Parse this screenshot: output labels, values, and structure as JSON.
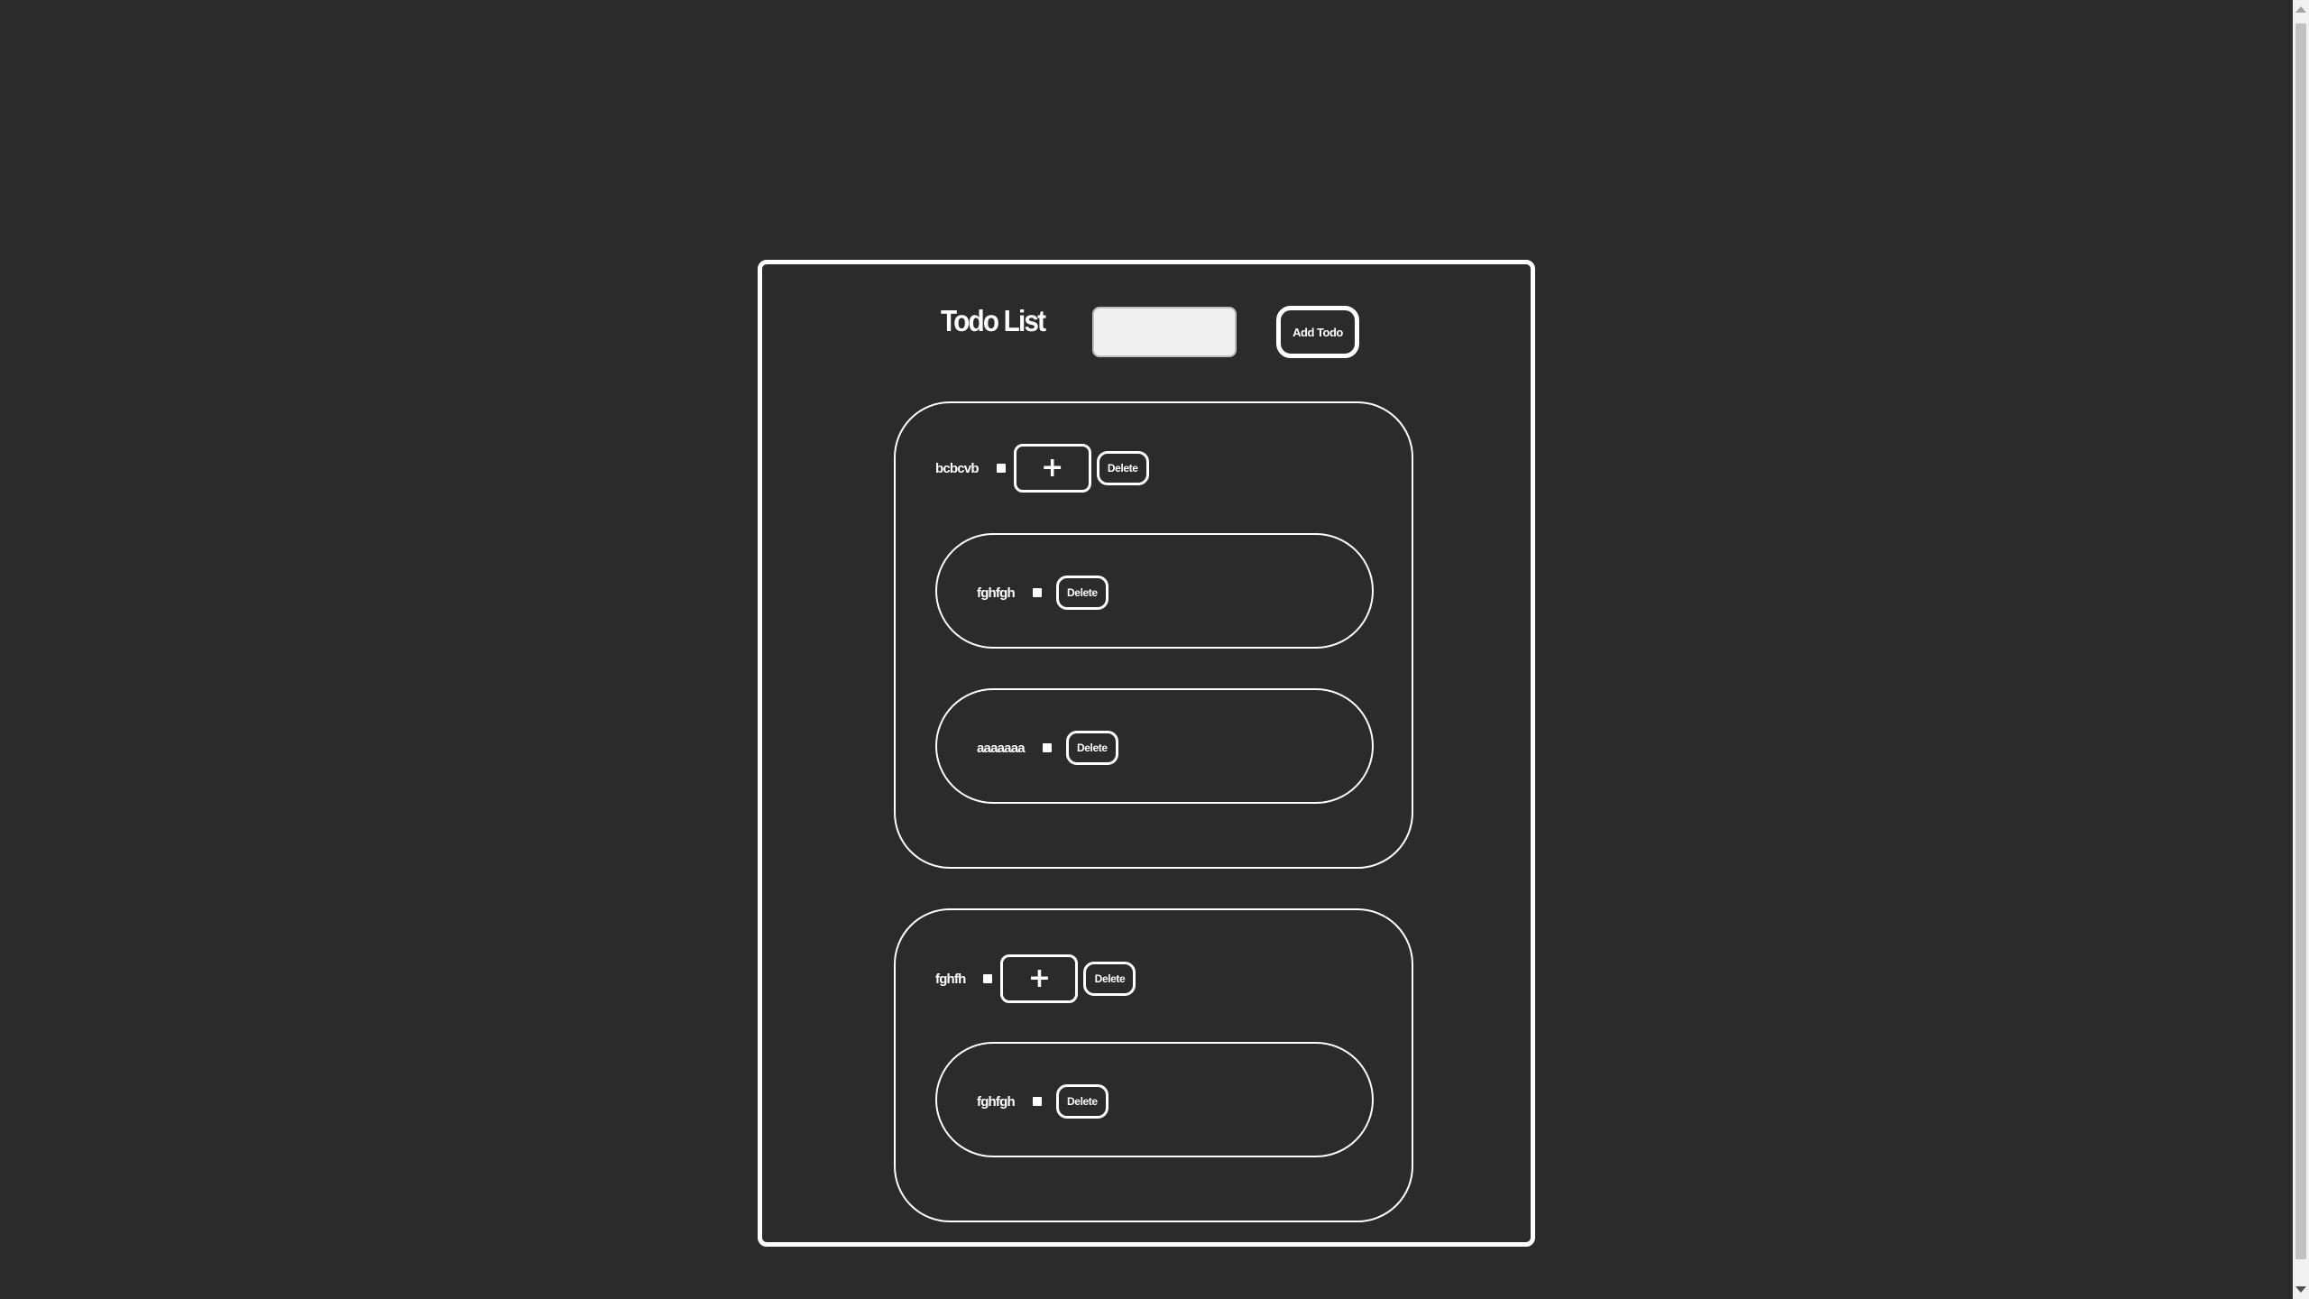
{
  "header": {
    "title": "Todo List",
    "input_value": "",
    "input_placeholder": "",
    "add_button_label": "Add Todo"
  },
  "todos": [
    {
      "label": "bcbcvb",
      "completed": false,
      "add_subtask_label": "+",
      "delete_label": "Delete",
      "subtasks": [
        {
          "label": "fghfgh",
          "completed": false,
          "delete_label": "Delete"
        },
        {
          "label": "aaaaaaa",
          "completed": false,
          "delete_label": "Delete"
        }
      ]
    },
    {
      "label": "fghfh",
      "completed": false,
      "add_subtask_label": "+",
      "delete_label": "Delete",
      "subtasks": [
        {
          "label": "fghfgh",
          "completed": false,
          "delete_label": "Delete"
        }
      ]
    }
  ],
  "colors": {
    "background": "#2b2b2b",
    "foreground": "#ffffff",
    "input_fill": "#f0f0f0"
  }
}
